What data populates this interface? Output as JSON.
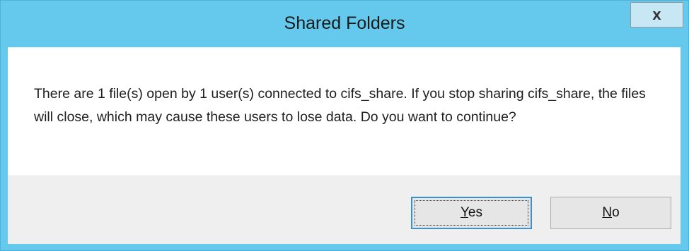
{
  "dialog": {
    "title": "Shared Folders",
    "close_glyph": "x",
    "message": "There are 1 file(s) open by 1 user(s) connected to cifs_share. If you stop sharing cifs_share, the files will close, which may cause these users to lose data. Do you want to continue?",
    "buttons": {
      "yes": {
        "access_key": "Y",
        "rest": "es"
      },
      "no": {
        "access_key": "N",
        "rest": "o"
      }
    }
  },
  "colors": {
    "frame": "#64c9ec",
    "default_button_border": "#3c8fd0"
  },
  "icons": {
    "close": "close-icon"
  }
}
